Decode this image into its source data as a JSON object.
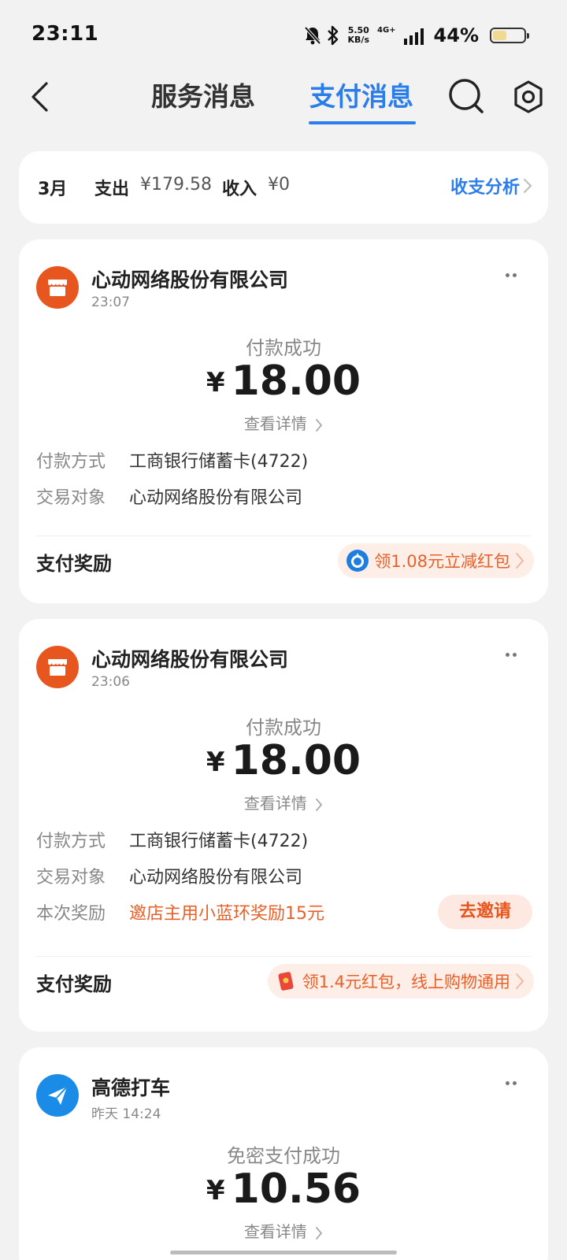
{
  "status_bar": {
    "time": "23:11",
    "net_speed_value": "5.50",
    "net_speed_unit": "KB/s",
    "network_type": "4G+",
    "battery_percent": "44%",
    "battery_level": 0.44,
    "icons": [
      "bell-off-icon",
      "bluetooth-icon",
      "signal-icon",
      "battery-icon"
    ]
  },
  "header": {
    "tabs": [
      {
        "label": "服务消息",
        "active": false
      },
      {
        "label": "支付消息",
        "active": true
      }
    ],
    "accent_color": "#2b7de9"
  },
  "summary": {
    "month": "3月",
    "expense_label": "支出",
    "expense_value": "¥179.58",
    "income_label": "收入",
    "income_value": "¥0",
    "analysis_label": "收支分析"
  },
  "transactions": [
    {
      "merchant": "心动网络股份有限公司",
      "time": "23:07",
      "status": "付款成功",
      "currency": "¥",
      "amount": "18.00",
      "detail_label": "查看详情",
      "pay_method_label": "付款方式",
      "pay_method": "工商银行储蓄卡(4722)",
      "counterparty_label": "交易对象",
      "counterparty": "心动网络股份有限公司",
      "reward_label": "支付奖励",
      "reward_text": "领1.08元立减红包"
    },
    {
      "merchant": "心动网络股份有限公司",
      "time": "23:06",
      "status": "付款成功",
      "currency": "¥",
      "amount": "18.00",
      "detail_label": "查看详情",
      "pay_method_label": "付款方式",
      "pay_method": "工商银行储蓄卡(4722)",
      "counterparty_label": "交易对象",
      "counterparty": "心动网络股份有限公司",
      "bonus_label": "本次奖励",
      "bonus_text": "邀店主用小蓝环奖励15元",
      "invite_label": "去邀请",
      "reward_label": "支付奖励",
      "reward_text": "领1.4元红包，线上购物通用"
    },
    {
      "merchant": "高德打车",
      "time": "昨天 14:24",
      "status": "免密支付成功",
      "currency": "¥",
      "amount": "10.56",
      "detail_label": "查看详情"
    }
  ]
}
